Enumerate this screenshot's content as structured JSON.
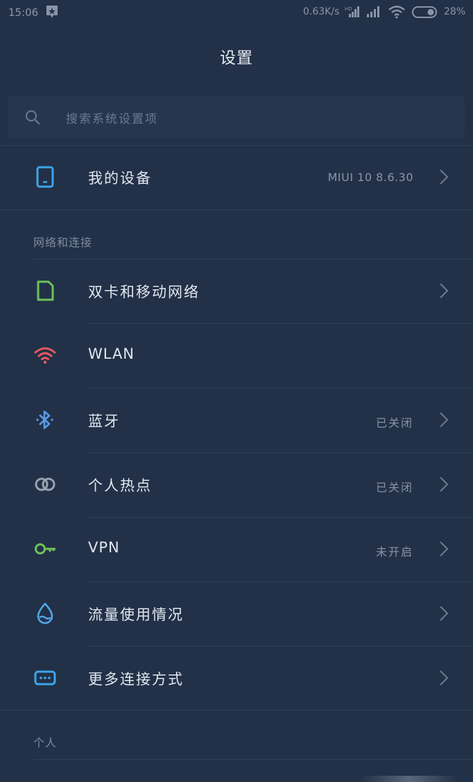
{
  "status_bar": {
    "time": "15:06",
    "net_speed": "0.63K/s",
    "battery": "28%"
  },
  "header": {
    "title": "设置"
  },
  "search": {
    "placeholder": "搜索系统设置项"
  },
  "device": {
    "label": "我的设备",
    "value": "MIUI 10 8.6.30"
  },
  "sections": {
    "network": "网络和连接",
    "personal": "个人"
  },
  "network_items": [
    {
      "label": "双卡和移动网络",
      "value": "",
      "icon": "sim-card-icon",
      "color": "#6cc35a"
    },
    {
      "label": "WLAN",
      "value": "",
      "icon": "wifi-icon",
      "color": "#e8595d"
    },
    {
      "label": "蓝牙",
      "value": "已关闭",
      "icon": "bluetooth-icon",
      "color": "#5b9be6"
    },
    {
      "label": "个人热点",
      "value": "已关闭",
      "icon": "hotspot-icon",
      "color": "#9aa3ae"
    },
    {
      "label": "VPN",
      "value": "未开启",
      "icon": "vpn-key-icon",
      "color": "#6cc35a"
    },
    {
      "label": "流量使用情况",
      "value": "",
      "icon": "data-usage-icon",
      "color": "#53a6e6"
    },
    {
      "label": "更多连接方式",
      "value": "",
      "icon": "more-connections-icon",
      "color": "#3ea5e9"
    }
  ],
  "colors": {
    "background": "#223148",
    "accent_blue": "#3ea5e9"
  }
}
